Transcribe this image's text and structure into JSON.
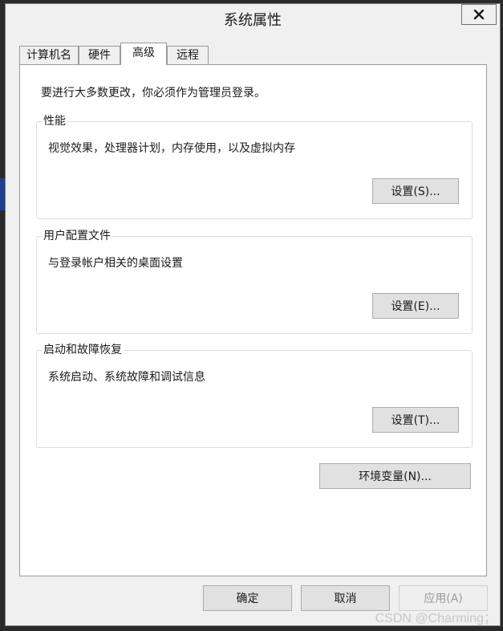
{
  "window": {
    "title": "系统属性",
    "close_label": "X"
  },
  "tabs": [
    {
      "label": "计算机名"
    },
    {
      "label": "硬件"
    },
    {
      "label": "高级"
    },
    {
      "label": "远程"
    }
  ],
  "panel": {
    "admin_note": "要进行大多数更改，你必须作为管理员登录。",
    "performance": {
      "legend": "性能",
      "description": "视觉效果，处理器计划，内存使用，以及虚拟内存",
      "button": "设置(S)..."
    },
    "user_profiles": {
      "legend": "用户配置文件",
      "description": "与登录帐户相关的桌面设置",
      "button": "设置(E)..."
    },
    "startup_recovery": {
      "legend": "启动和故障恢复",
      "description": "系统启动、系统故障和调试信息",
      "button": "设置(T)..."
    },
    "env_vars_button": "环境变量(N)..."
  },
  "footer": {
    "ok": "确定",
    "cancel": "取消",
    "apply": "应用(A)"
  },
  "watermark": "CSDN @Charming；",
  "colors": {
    "window_bg": "#f0f0f0",
    "panel_bg": "#ffffff",
    "button_bg": "#e1e1e1",
    "disabled_text": "#9a9a9a"
  }
}
